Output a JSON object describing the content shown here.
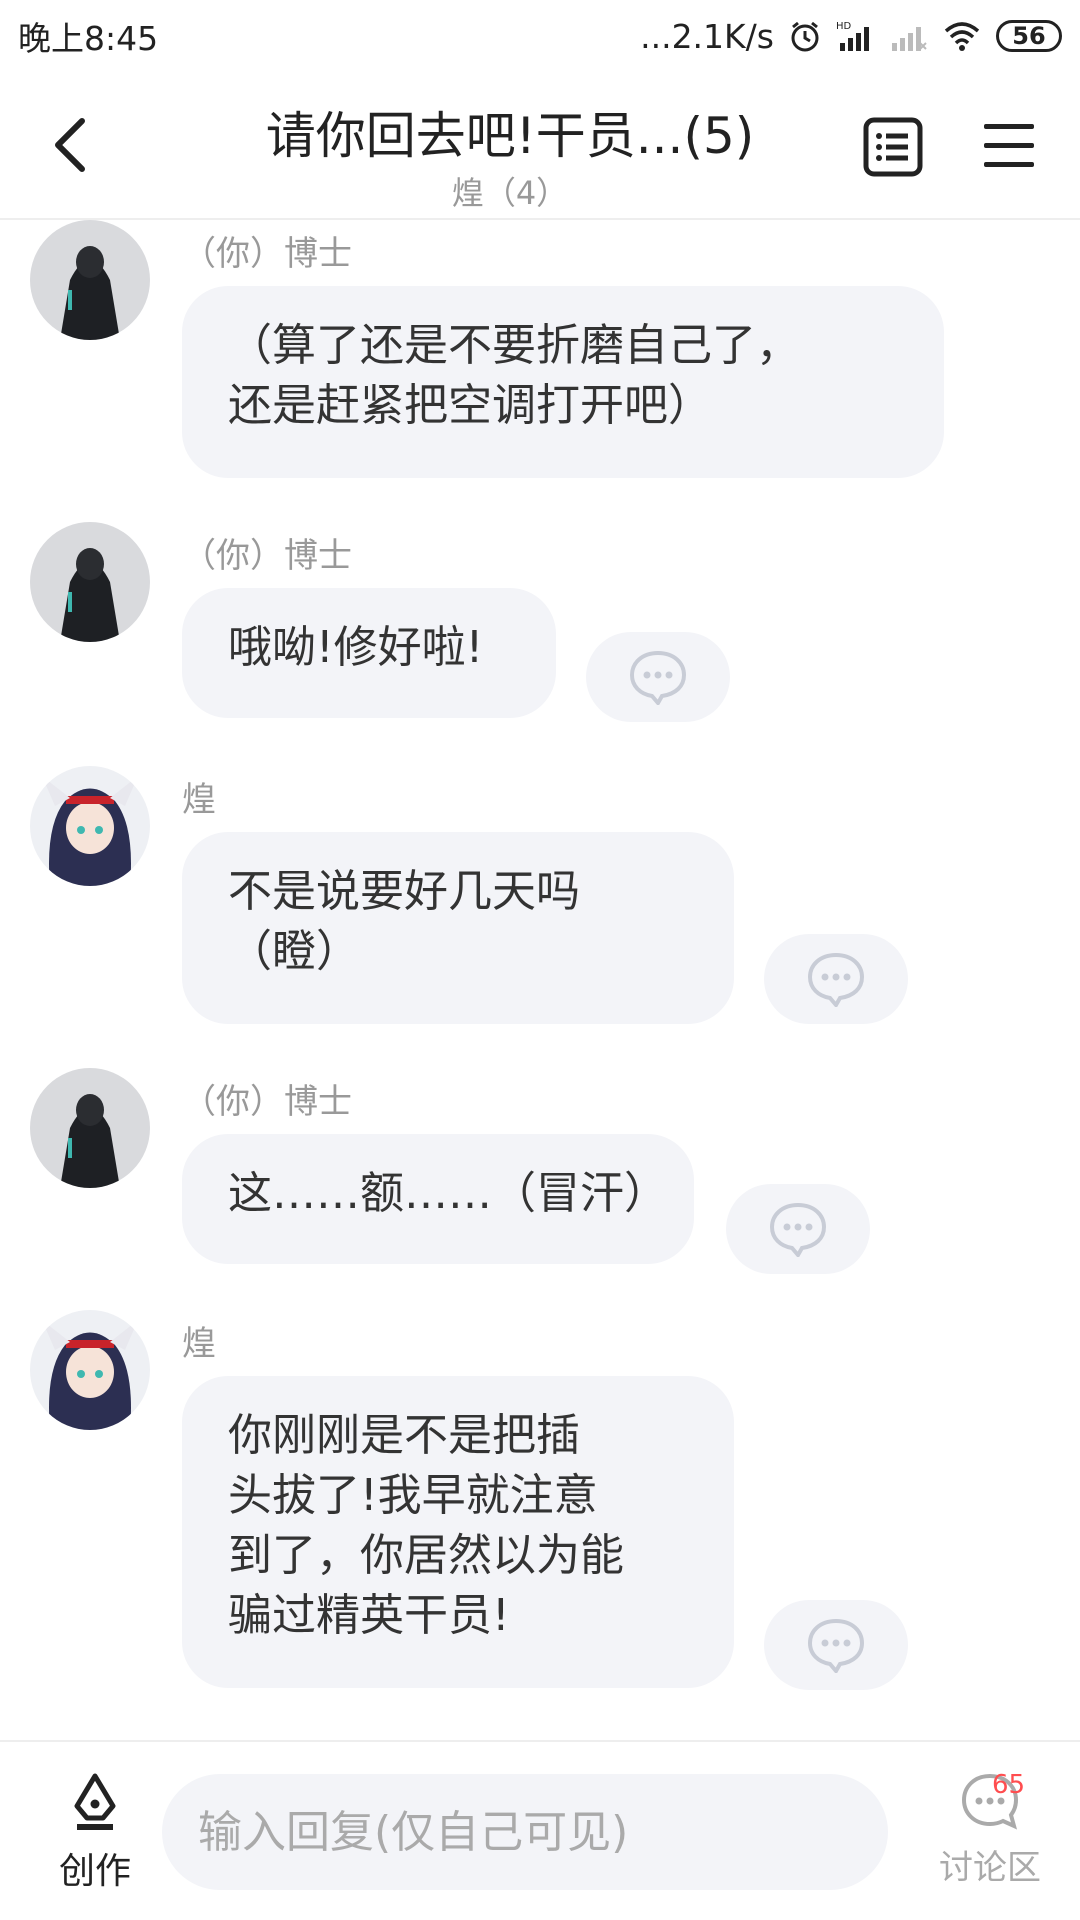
{
  "status_bar": {
    "time": "晚上8:45",
    "network_speed": "...2.1K/s",
    "battery": "56",
    "icons": [
      "alarm-icon",
      "hd-signal-icon",
      "signal-icon",
      "wifi-icon",
      "battery-icon"
    ]
  },
  "header": {
    "title": "请你回去吧!干员...(5)",
    "subtitle": "煌（4）"
  },
  "messages": [
    {
      "sender": "（你）博士",
      "text": "（算了还是不要折磨自己了，\n还是赶紧把空调打开吧）",
      "avatar": "doctor"
    },
    {
      "sender": "（你）博士",
      "text": "哦呦!修好啦!",
      "avatar": "doctor"
    },
    {
      "sender": "煌",
      "text": "不是说要好几天吗\n（瞪）",
      "avatar": "blaze"
    },
    {
      "sender": "（你）博士",
      "text": "这……额……（冒汗）",
      "avatar": "doctor"
    },
    {
      "sender": "煌",
      "text": "你刚刚是不是把插\n头拔了!我早就注意\n到了，你居然以为能\n骗过精英干员!",
      "avatar": "blaze"
    }
  ],
  "bottom_bar": {
    "create_label": "创作",
    "reply_placeholder": "输入回复(仅自己可见)",
    "discuss_label": "讨论区",
    "discuss_count": "65"
  },
  "colors": {
    "bubble": "#f3f4f8",
    "badge": "#ff4d4f",
    "muted_text": "#999999"
  }
}
